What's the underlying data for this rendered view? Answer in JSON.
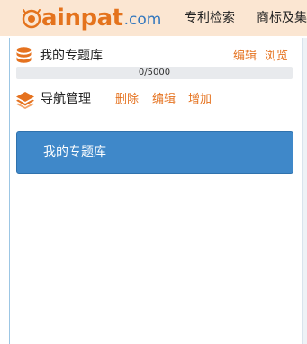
{
  "header": {
    "logo_text": "ainpat",
    "logo_suffix": ".com",
    "nav": [
      "专利检索",
      "商标及集"
    ]
  },
  "library": {
    "icon": "database-icon",
    "label": "我的专题库",
    "edit_label": "编辑",
    "browse_label": "浏览",
    "usage_text": "0/5000",
    "usage_fraction": 0
  },
  "navigation": {
    "icon": "layers-icon",
    "label": "导航管理",
    "delete_label": "删除",
    "edit_label": "编辑",
    "add_label": "增加"
  },
  "my_library_button": {
    "label": "我的专题库"
  },
  "colors": {
    "header_bg": "#fbe6d2",
    "accent_orange": "#e5721f",
    "accent_blue": "#3f88c9",
    "panel_border": "#9cc6e4"
  }
}
